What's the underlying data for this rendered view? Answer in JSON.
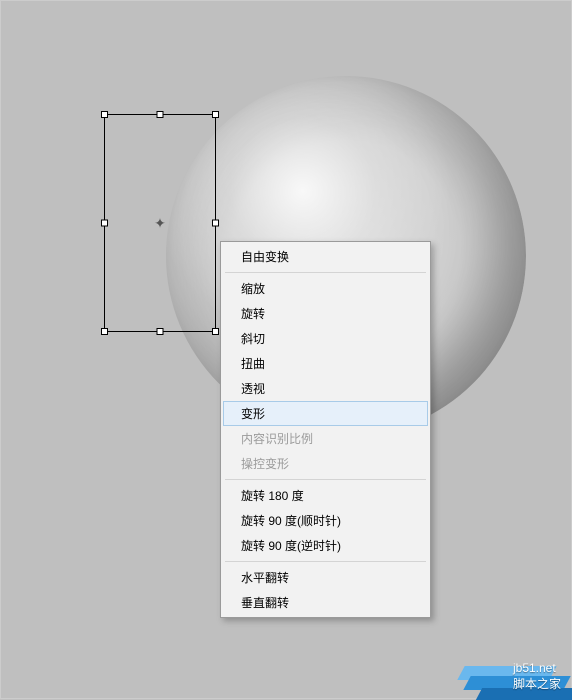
{
  "menu": {
    "free_transform": "自由变换",
    "scale": "缩放",
    "rotate": "旋转",
    "skew": "斜切",
    "distort": "扭曲",
    "perspective": "透视",
    "warp": "变形",
    "content_aware_scale": "内容识别比例",
    "puppet_warp": "操控变形",
    "rotate_180": "旋转 180 度",
    "rotate_90_cw": "旋转 90 度(顺时针)",
    "rotate_90_ccw": "旋转 90 度(逆时针)",
    "flip_horizontal": "水平翻转",
    "flip_vertical": "垂直翻转"
  },
  "watermark": {
    "text": "jb51.net",
    "label": "脚本之家"
  }
}
